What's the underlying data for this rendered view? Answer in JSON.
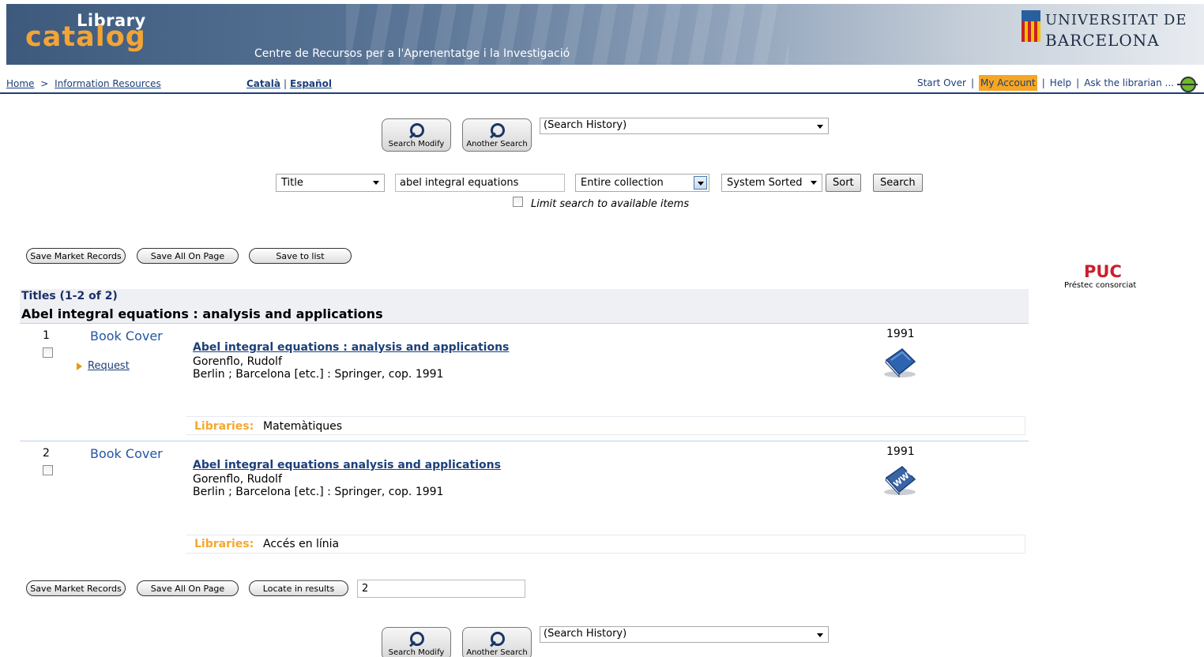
{
  "banner": {
    "logo_top": "Library",
    "logo_bottom": "catalog",
    "subtitle": "Centre de Recursos per a l'Aprenentatge i la Investigació",
    "university_line1": "UNIVERSITAT DE",
    "university_line2": "BARCELONA"
  },
  "nav": {
    "breadcrumb_home": "Home",
    "breadcrumb_sep": ">",
    "breadcrumb_resources": "Information Resources",
    "lang_catala": "Català",
    "lang_sep": "|",
    "lang_espanol": "Español",
    "start_over": "Start Over",
    "my_account": "My Account",
    "help": "Help",
    "ask": "Ask the librarian ...",
    "pipe": "|"
  },
  "toolbar": {
    "search_modify": "Search Modify",
    "another_search": "Another Search",
    "history_selected": "(Search History)"
  },
  "search": {
    "field_selected": "Title",
    "query": "abel integral equations",
    "scope_selected": "Entire collection",
    "sort_selected": "System Sorted",
    "sort_button": "Sort",
    "search_button": "Search",
    "limit_label": "Limit search to available items"
  },
  "actions_top": {
    "save_marked": "Save Market Records",
    "save_all": "Save All On Page",
    "save_list": "Save to list"
  },
  "puc": {
    "logo": "PUC",
    "caption": "Préstec consorciat"
  },
  "results": {
    "titles_label": "Titles (1-2 of 2)",
    "group_title": "Abel integral equations : analysis and applications",
    "items": [
      {
        "number": "1",
        "cover": "Book Cover",
        "request": "Request",
        "title": "Abel integral equations : analysis and applications",
        "author": "Gorenflo, Rudolf",
        "publisher": "Berlin ; Barcelona [etc.] : Springer, cop. 1991",
        "year": "1991",
        "format_icon": "book-icon",
        "libraries_label": "Libraries:",
        "libraries": "Matemàtiques"
      },
      {
        "number": "2",
        "cover": "Book Cover",
        "title": "Abel integral equations analysis and applications",
        "author": "Gorenflo, Rudolf",
        "publisher": "Berlin ; Barcelona [etc.] : Springer, cop. 1991",
        "year": "1991",
        "format_icon": "www-icon",
        "libraries_label": "Libraries:",
        "libraries": "Accés en línia"
      }
    ]
  },
  "actions_bottom": {
    "save_marked": "Save Market Records",
    "save_all": "Save All On Page",
    "locate": "Locate in results",
    "locate_value": "2"
  },
  "colors": {
    "accent": "#1c3f7a",
    "highlight": "#f6a623",
    "libraries_label": "#f4a831",
    "puc_red": "#c8202b"
  }
}
